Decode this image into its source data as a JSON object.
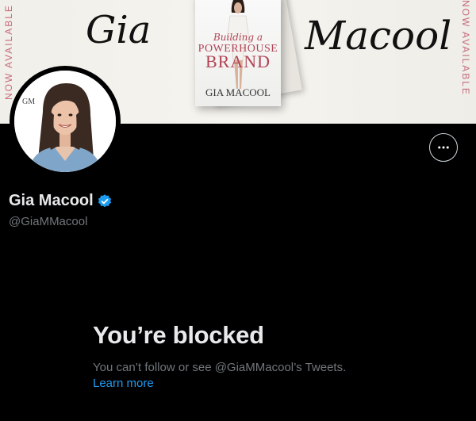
{
  "banner": {
    "side_left": "NOW AVAILABLE",
    "side_right": "NOW AVAILABLE",
    "script_first": "Gia",
    "script_last": "Macool",
    "book": {
      "title_line1": "Building a",
      "title_line2": "POWERHOUSE",
      "title_line3": "BRAND",
      "author": "GIA MACOOL"
    }
  },
  "avatar": {
    "monogram": "GM"
  },
  "more_button": {
    "icon": "more-horizontal-icon",
    "glyph": "•••"
  },
  "profile": {
    "display_name": "Gia Macool",
    "handle": "@GiaMMacool",
    "verified_color": "#1d9bf0"
  },
  "blocked": {
    "title": "You’re blocked",
    "description": "You can’t follow or see @GiaMMacool’s Tweets.",
    "learn_more": "Learn more"
  },
  "colors": {
    "background": "#000000",
    "text_primary": "#e7e9ea",
    "text_secondary": "#71767b",
    "link": "#1d9bf0",
    "accent_pink": "#c56b7b"
  }
}
